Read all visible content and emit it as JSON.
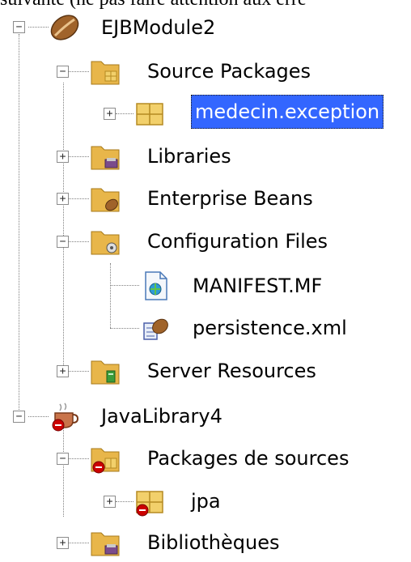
{
  "top_text": "suivante (ne pas faire attention aux erre",
  "tree": {
    "ejb_module": {
      "label": "EJBModule2",
      "source_packages": {
        "label": "Source Packages",
        "child": "medecin.exception"
      },
      "libraries": "Libraries",
      "enterprise_beans": "Enterprise Beans",
      "configuration_files": {
        "label": "Configuration Files",
        "children": [
          "MANIFEST.MF",
          "persistence.xml"
        ]
      },
      "server_resources": "Server Resources"
    },
    "java_library": {
      "label": "JavaLibrary4",
      "packages_de_sources": {
        "label": "Packages de sources",
        "child": "jpa"
      },
      "bibliotheques": "Bibliothèques"
    }
  },
  "icons": {
    "ejb_module": "bean-module-icon",
    "folder": "folder-icon",
    "package": "package-icon",
    "java_library": "coffee-cup-error-icon",
    "manifest": "manifest-file-icon",
    "persistence": "persistence-xml-icon"
  },
  "colors": {
    "selection": "#3366ff",
    "folder": "#e8b64a",
    "error": "#cc0000",
    "bean": "#a0632a"
  }
}
